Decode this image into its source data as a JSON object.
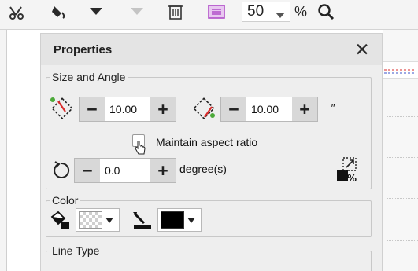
{
  "toolbar": {
    "icons": [
      "scissors-icon",
      "fill-bucket-icon",
      "arrow-down-icon",
      "arrow-down-disabled-icon",
      "trash-icon",
      "text-frame-icon",
      "zoom-icon"
    ],
    "zoom_value": "50",
    "zoom_unit": "%"
  },
  "properties": {
    "title": "Properties",
    "close_glyph": "✕",
    "size_and_angle": {
      "legend": "Size and Angle",
      "width_value": "10.00",
      "height_value": "10.00",
      "unit": "″",
      "minus": "−",
      "plus": "+",
      "maintain_aspect_ratio_label": "Maintain aspect ratio",
      "maintain_aspect_ratio_checked": false,
      "angle_value": "0.0",
      "angle_unit": "degree(s)"
    },
    "color": {
      "legend": "Color",
      "fill_swatch": "transparent",
      "line_swatch": "#000000"
    },
    "line_type": {
      "legend": "Line Type"
    }
  },
  "colors": {
    "accent_red": "#d92b2b",
    "icon_green": "#4caa3a",
    "text_frame_purple": "#b04ec8"
  }
}
